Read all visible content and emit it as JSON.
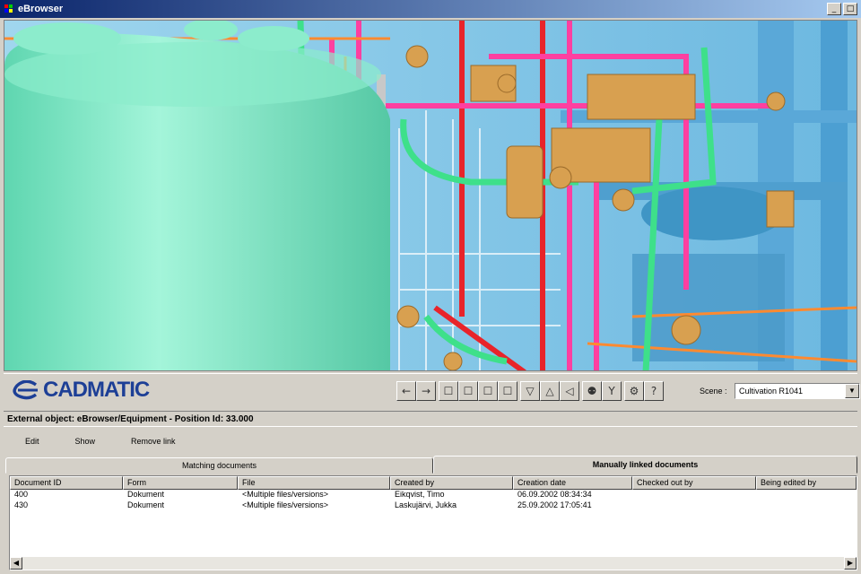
{
  "window": {
    "title": "eBrowser",
    "controls": [
      "_",
      "□"
    ]
  },
  "viewport": {
    "label": "3D plant model view"
  },
  "logo": {
    "text": "CADMATIC"
  },
  "toolbar": {
    "buttons": [
      {
        "name": "back-icon",
        "glyph": "←"
      },
      {
        "name": "forward-icon",
        "glyph": "→"
      },
      {
        "name": "view-front-icon",
        "glyph": "☐"
      },
      {
        "name": "view-back-icon",
        "glyph": "☐"
      },
      {
        "name": "view-left-icon",
        "glyph": "☐"
      },
      {
        "name": "view-right-icon",
        "glyph": "☐"
      },
      {
        "name": "view-down-icon",
        "glyph": "▽"
      },
      {
        "name": "view-up-icon",
        "glyph": "△"
      },
      {
        "name": "view-side-icon",
        "glyph": "◁"
      },
      {
        "name": "binoculars-icon",
        "glyph": "⚉"
      },
      {
        "name": "filter-icon",
        "glyph": "Y"
      },
      {
        "name": "settings-icon",
        "glyph": "⚙"
      },
      {
        "name": "help-icon",
        "glyph": "?"
      }
    ],
    "scene_label": "Scene :",
    "scene_value": "Cultivation R1041"
  },
  "object_bar": {
    "text": "External object: eBrowser/Equipment - Position Id: 33.000"
  },
  "actions": {
    "edit": "Edit",
    "show": "Show",
    "remove": "Remove link"
  },
  "tabs": {
    "matching": "Matching documents",
    "manual": "Manually linked documents"
  },
  "table": {
    "columns": [
      "Document ID",
      "Form",
      "File",
      "Created by",
      "Creation date",
      "Checked out by",
      "Being edited by"
    ],
    "rows": [
      [
        "400",
        "Dokument",
        "<Multiple files/versions>",
        "Eikqvist, Timo",
        "06.09.2002 08:34:34",
        "",
        ""
      ],
      [
        "430",
        "Dokument",
        "<Multiple files/versions>",
        "Laskujärvi, Jukka",
        "25.09.2002 17:05:41",
        "",
        ""
      ]
    ]
  },
  "colors": {
    "title_start": "#0a246a",
    "title_end": "#a6caf0",
    "logo": "#1d3f96",
    "tank": "#7ee6c0",
    "pipe_pink": "#ff3fa0",
    "pipe_green": "#3ee08a",
    "valve": "#d8a050"
  }
}
